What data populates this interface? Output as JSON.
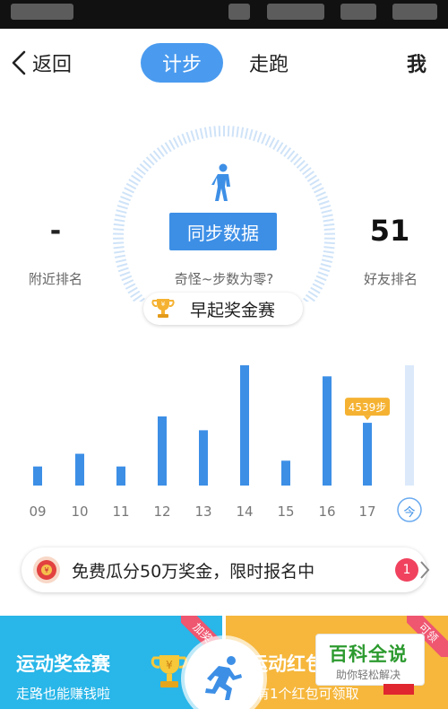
{
  "nav": {
    "back_label": "返回",
    "tab_steps": "计步",
    "tab_run": "走跑",
    "me_label": "我"
  },
  "summary": {
    "left_value": "-",
    "left_label": "附近排名",
    "sync_button": "同步数据",
    "hint": "奇怪~步数为零?",
    "right_value": "51",
    "right_label": "好友排名"
  },
  "contest_pill": "早起奖金赛",
  "chart_data": {
    "type": "bar",
    "categories": [
      "09",
      "10",
      "11",
      "12",
      "13",
      "14",
      "15",
      "16",
      "17",
      "今"
    ],
    "values": [
      1380,
      2300,
      1380,
      5000,
      4000,
      8700,
      1800,
      7900,
      4539,
      8700
    ],
    "highlight": {
      "index": 8,
      "label": "4539步"
    },
    "colors": {
      "bar": "#3d8fe6",
      "today_bar": "#dbe9fb",
      "tooltip": "#f5b232"
    }
  },
  "banner": {
    "text": "免费瓜分50万奖金，限时报名中",
    "badge": "1"
  },
  "cards": {
    "left_title": "运动奖金赛",
    "left_sub": "走路也能赚钱啦",
    "left_ribbon": "加奖",
    "right_title": "运动红包",
    "right_sub": "有1个红包可领取",
    "right_ribbon": "可领"
  },
  "watermark": {
    "title": "百科全说",
    "sub": "助你轻松解决"
  },
  "colors": {
    "accent": "#4a9bef",
    "card_left": "#29b6e8",
    "card_right": "#f6b73c"
  }
}
